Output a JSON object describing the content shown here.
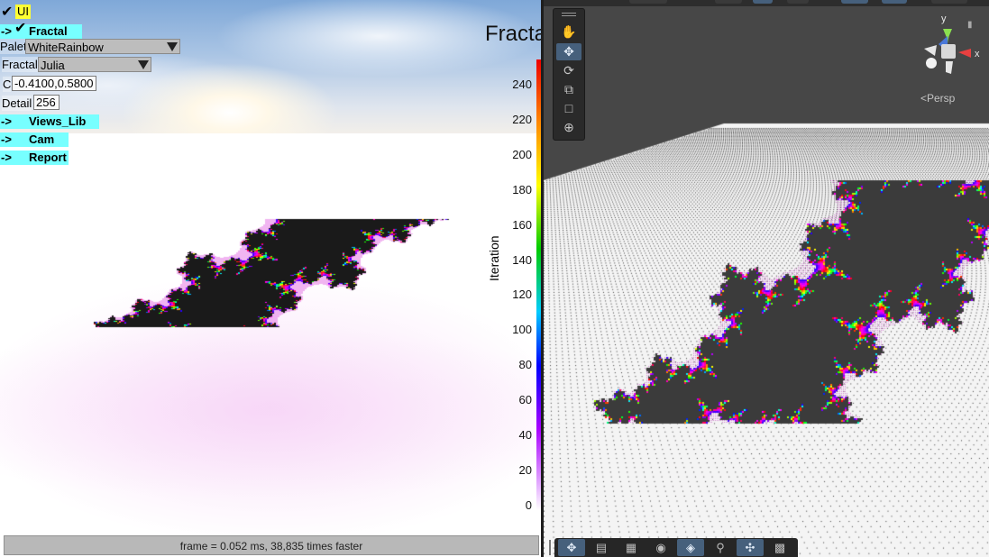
{
  "game_view": {
    "ui_toggle": "UI",
    "fractal_toggle": "Fractal",
    "arrow": "->",
    "palette_label": "Palett",
    "palette_value": "WhiteRainbow",
    "fractal_label": "Fractal",
    "fractal_value": "Julia",
    "c_label": "C",
    "c_value": "-0.4100,0.5800",
    "detail_label": "Detail",
    "detail_value": "256",
    "views_lib": "Views_Lib",
    "cam": "Cam",
    "report": "Report",
    "title_fragment": "Fracta",
    "colorbar": {
      "axis_label": "Iteration",
      "ticks": [
        "240",
        "220",
        "200",
        "180",
        "160",
        "140",
        "120",
        "100",
        "80",
        "60",
        "40",
        "20",
        "0"
      ]
    },
    "status": "frame = 0.052 ms, 38,835 times faster"
  },
  "scene_view": {
    "persp_label": "<Persp",
    "gizmo": {
      "y": "y",
      "x": "x"
    },
    "tools": [
      "hand-icon",
      "move-icon",
      "rotate-icon",
      "scale-icon",
      "rect-icon",
      "transform-icon"
    ],
    "bottom_tools": [
      "move-icon",
      "panel-icon",
      "grid-icon",
      "globe-icon",
      "layers-icon",
      "search-icon",
      "pivot-icon",
      "overlay-icon"
    ]
  },
  "colors": {
    "toggle_bg": "#7fffff",
    "ui_highlight": "#ffff33",
    "scene_bg": "#474747",
    "active_tool": "#46607c"
  }
}
